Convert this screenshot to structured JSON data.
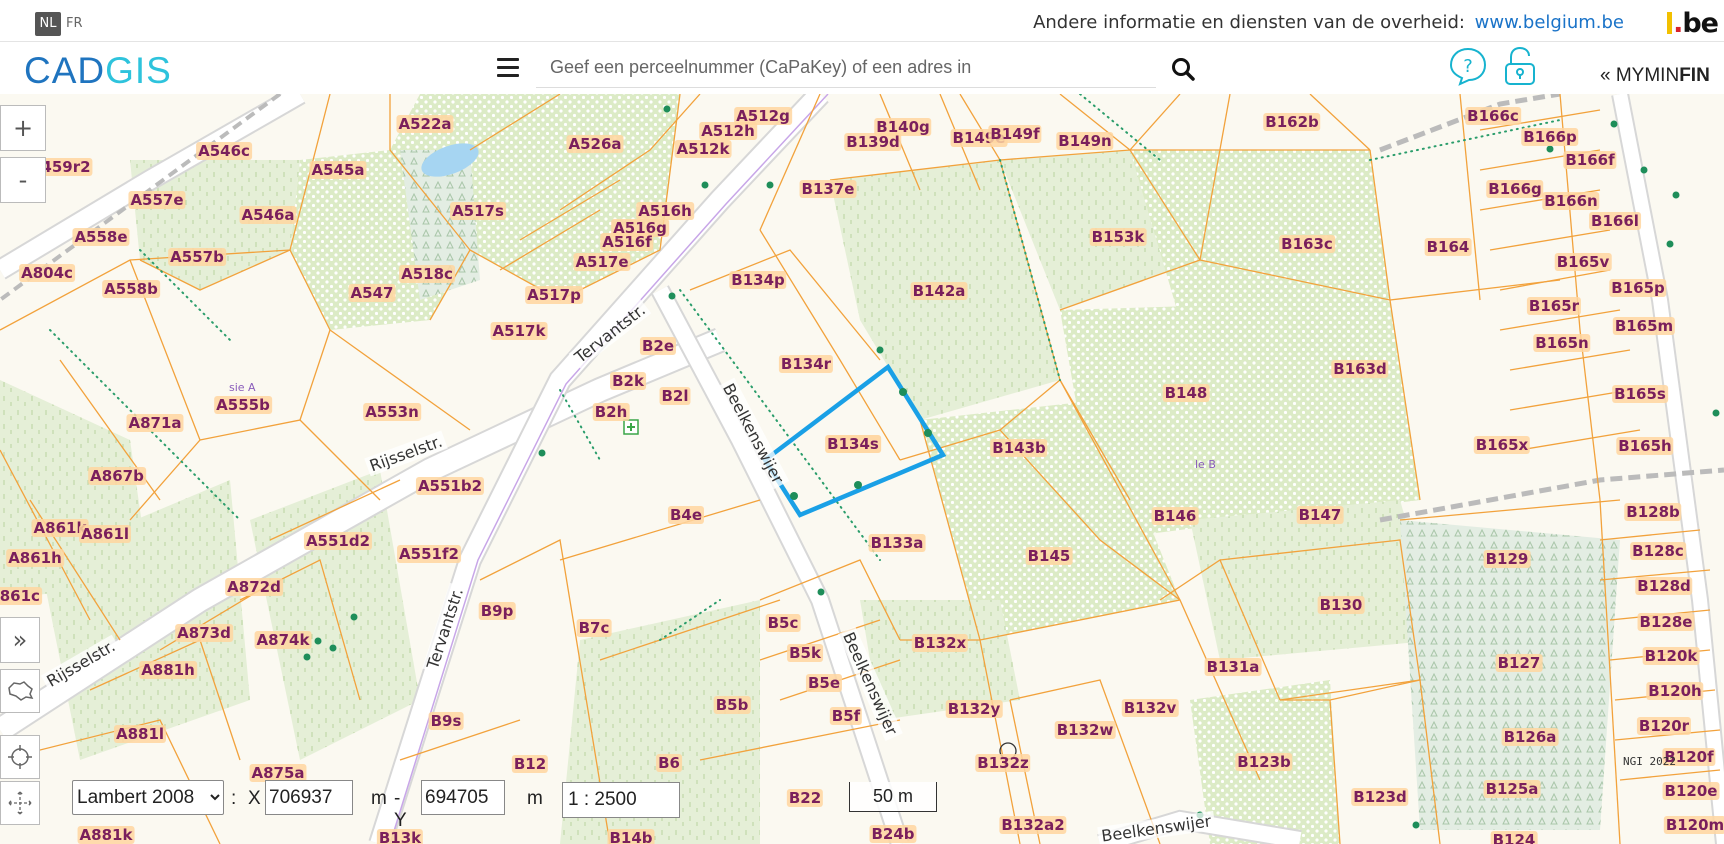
{
  "topbar": {
    "lang_active": "NL",
    "lang_other": "FR",
    "gov_text": "Andere informatie en diensten van de overheid:",
    "gov_link": "www.belgium.be",
    "be_logo": "be"
  },
  "header": {
    "logo_cad": "CAD",
    "logo_gis": "GIS",
    "search_placeholder": "Geef een perceelnummer (CaPaKey) of een adres in",
    "myminfin_prefix": "« MYMIN",
    "myminfin_bold": "FIN"
  },
  "map": {
    "parcels": [
      {
        "id": "A522a"
      },
      {
        "id": "A526a"
      },
      {
        "id": "A512g"
      },
      {
        "id": "A512h"
      },
      {
        "id": "A512k"
      },
      {
        "id": "B140g"
      },
      {
        "id": "B139d"
      },
      {
        "id": "B149e"
      },
      {
        "id": "B149f"
      },
      {
        "id": "B149n"
      },
      {
        "id": "B162b"
      },
      {
        "id": "B166c"
      },
      {
        "id": "B166p"
      },
      {
        "id": "B166f"
      },
      {
        "id": "B166g"
      },
      {
        "id": "B166n"
      },
      {
        "id": "B166l"
      },
      {
        "id": "459r2"
      },
      {
        "id": "A546c"
      },
      {
        "id": "A545a"
      },
      {
        "id": "A557e"
      },
      {
        "id": "A546a"
      },
      {
        "id": "A517s"
      },
      {
        "id": "B137e"
      },
      {
        "id": "A516h"
      },
      {
        "id": "A516g"
      },
      {
        "id": "A516f"
      },
      {
        "id": "A517e"
      },
      {
        "id": "A558e"
      },
      {
        "id": "A804c"
      },
      {
        "id": "A557b"
      },
      {
        "id": "A558b"
      },
      {
        "id": "A518c"
      },
      {
        "id": "A547"
      },
      {
        "id": "A517p"
      },
      {
        "id": "A517k"
      },
      {
        "id": "B134p"
      },
      {
        "id": "B142a"
      },
      {
        "id": "B153k"
      },
      {
        "id": "B163c"
      },
      {
        "id": "B164"
      },
      {
        "id": "B165v"
      },
      {
        "id": "B165p"
      },
      {
        "id": "B165r"
      },
      {
        "id": "B165m"
      },
      {
        "id": "B165n"
      },
      {
        "id": "B2e"
      },
      {
        "id": "B134r"
      },
      {
        "id": "B2k"
      },
      {
        "id": "B2l"
      },
      {
        "id": "B2h"
      },
      {
        "id": "A555b"
      },
      {
        "id": "A553n"
      },
      {
        "id": "A871a"
      },
      {
        "id": "B148"
      },
      {
        "id": "B163d"
      },
      {
        "id": "B165s"
      },
      {
        "id": "B134s"
      },
      {
        "id": "B143b"
      },
      {
        "id": "B165x"
      },
      {
        "id": "B165h"
      },
      {
        "id": "A867b"
      },
      {
        "id": "A551b2"
      },
      {
        "id": "B4e"
      },
      {
        "id": "B146"
      },
      {
        "id": "B147"
      },
      {
        "id": "B128b"
      },
      {
        "id": "A861k"
      },
      {
        "id": "A861l"
      },
      {
        "id": "A861h"
      },
      {
        "id": "A551d2"
      },
      {
        "id": "A551f2"
      },
      {
        "id": "B133a"
      },
      {
        "id": "B145"
      },
      {
        "id": "B129"
      },
      {
        "id": "B128c"
      },
      {
        "id": "A872d"
      },
      {
        "id": "A861c"
      },
      {
        "id": "B9p"
      },
      {
        "id": "B130"
      },
      {
        "id": "B128d"
      },
      {
        "id": "A873d"
      },
      {
        "id": "A874k"
      },
      {
        "id": "B7c"
      },
      {
        "id": "B5c"
      },
      {
        "id": "B132x"
      },
      {
        "id": "B128e"
      },
      {
        "id": "A881h"
      },
      {
        "id": "B5k"
      },
      {
        "id": "B131a"
      },
      {
        "id": "B127"
      },
      {
        "id": "B120k"
      },
      {
        "id": "B5e"
      },
      {
        "id": "B5b"
      },
      {
        "id": "B132y"
      },
      {
        "id": "B132v"
      },
      {
        "id": "B120h"
      },
      {
        "id": "B5f"
      },
      {
        "id": "B132w"
      },
      {
        "id": "B126a"
      },
      {
        "id": "A881l"
      },
      {
        "id": "B9s"
      },
      {
        "id": "B120r"
      },
      {
        "id": "A875a"
      },
      {
        "id": "B12"
      },
      {
        "id": "B6"
      },
      {
        "id": "B132z"
      },
      {
        "id": "B123b"
      },
      {
        "id": "B120f"
      },
      {
        "id": "B125a"
      },
      {
        "id": "B120e"
      },
      {
        "id": "B22"
      },
      {
        "id": "B123d"
      },
      {
        "id": "B132a2"
      },
      {
        "id": "A881k"
      },
      {
        "id": "B13k"
      },
      {
        "id": "B14b"
      },
      {
        "id": "B24b"
      },
      {
        "id": "B124"
      },
      {
        "id": "B120m"
      }
    ],
    "streets": [
      "Tervantstr.",
      "Rijsselstr.",
      "Beelkenswijer",
      "Rijsselstr.",
      "Tervantstr.",
      "Beelkenswijer",
      "Beelkenswijer"
    ],
    "small_labels": [
      "sie A",
      "le B"
    ],
    "selected_parcel": "B134s",
    "attribution": "NGI 2022",
    "colors": {
      "parcel_line": "#f2a23c",
      "selection": "#1aa0e6",
      "label_text": "#7a1f5c",
      "green_area": "#dcebc6",
      "road": "#ffffff"
    }
  },
  "controls": {
    "zoom_in": "+",
    "zoom_out": "-",
    "panel_toggle": "»"
  },
  "coords": {
    "crs": "Lambert 2008",
    "colon": ":",
    "x_label": "X",
    "x_value": "706937",
    "x_unit": "m",
    "y_label": "- Y",
    "y_value": "694705",
    "y_unit": "m",
    "scale": "1 : 2500",
    "scalebar": "50 m"
  }
}
